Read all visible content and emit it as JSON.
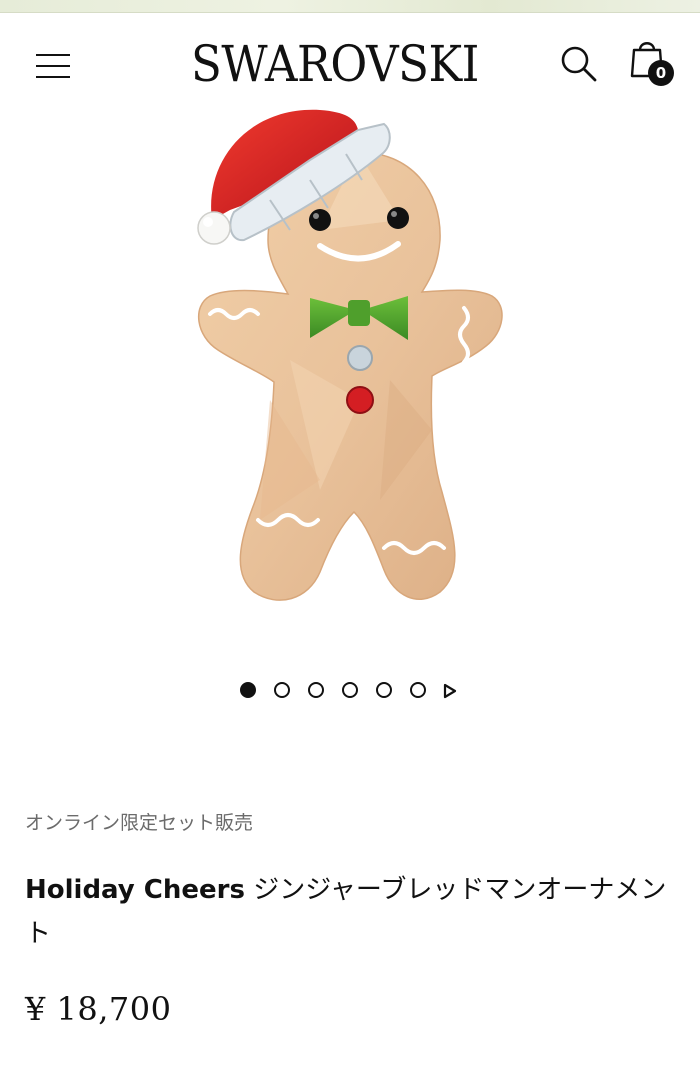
{
  "header": {
    "brand": "SWAROVSKI",
    "menu_icon": "hamburger-menu-icon",
    "search_icon": "search-icon",
    "bag_icon": "shopping-bag-icon",
    "bag_count": "0"
  },
  "gallery": {
    "image_subject": "gingerbread-man-ornament",
    "total_images": 6,
    "active_index": 0,
    "next_icon": "play-arrow-icon"
  },
  "product": {
    "tag": "オンライン限定セット販売",
    "title_brand": "Holiday Cheers",
    "title_rest": " ジンジャーブレッドマンオーナメント",
    "price": "¥ 18,700"
  },
  "colors": {
    "text": "#111111",
    "muted": "#6b6b6b",
    "background": "#ffffff"
  }
}
